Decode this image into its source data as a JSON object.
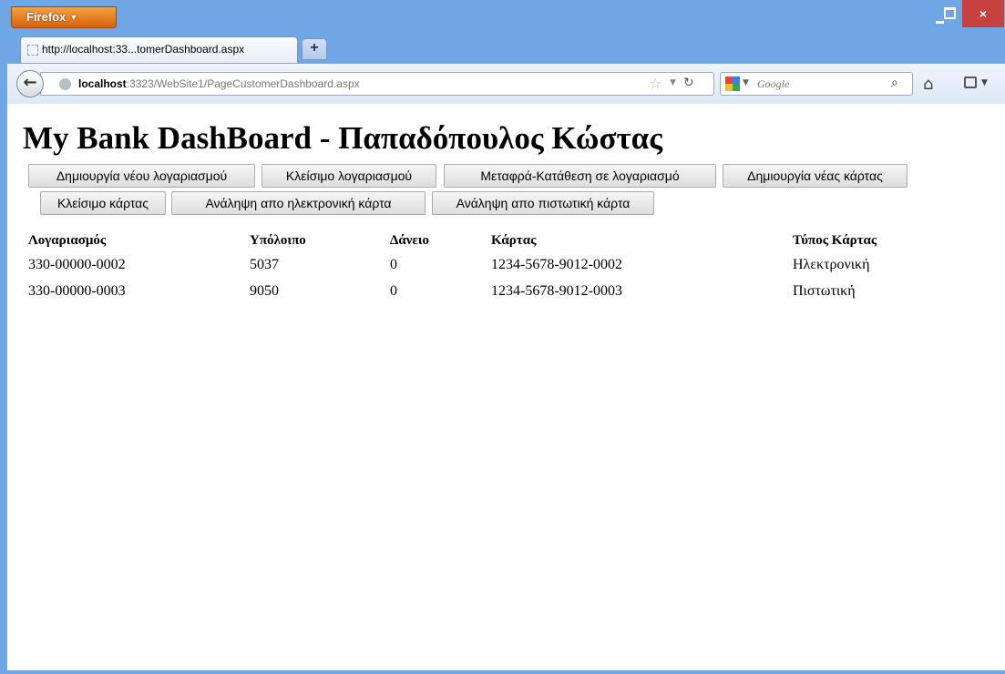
{
  "browser": {
    "menu_label": "Firefox",
    "tab_title": "http://localhost:33...tomerDashboard.aspx",
    "new_tab_label": "+",
    "url_host": "localhost",
    "url_rest": ":3323/WebSite1/PageCustomerDashboard.aspx",
    "search_placeholder": "Google",
    "icons": [
      "back-arrow-icon",
      "globe-icon",
      "star-icon",
      "reload-icon",
      "google-icon",
      "search-icon",
      "home-icon",
      "bookmarks-icon"
    ]
  },
  "window_controls": {
    "minimize": "minimize",
    "maximize": "maximize",
    "close": "×"
  },
  "page": {
    "title": "My Bank DashBoard - Παπαδόπουλος Κώστας",
    "buttons_row1": [
      "Δημιουργία νέου λογαριασμού",
      "Κλείσιμο λογαριασμού",
      "Μεταφρά-Κατάθεση σε λογαριασμό",
      "Δημιουργία νέας κάρτας"
    ],
    "buttons_row2": [
      "Κλείσιμο κάρτας",
      "Ανάληψη απο ηλεκτρονική κάρτα",
      "Ανάληψη απο πιστωτική κάρτα"
    ],
    "table": {
      "headers": [
        "Λογαριασμός",
        "Υπόλοιπο",
        "Δάνειο",
        "Κάρτας",
        "Τύπος Κάρτας"
      ],
      "rows": [
        [
          "330-00000-0002",
          "5037",
          "0",
          "1234-5678-9012-0002",
          "Ηλεκτρονική"
        ],
        [
          "330-00000-0003",
          "9050",
          "0",
          "1234-5678-9012-0003",
          "Πιστωτική"
        ]
      ]
    }
  }
}
